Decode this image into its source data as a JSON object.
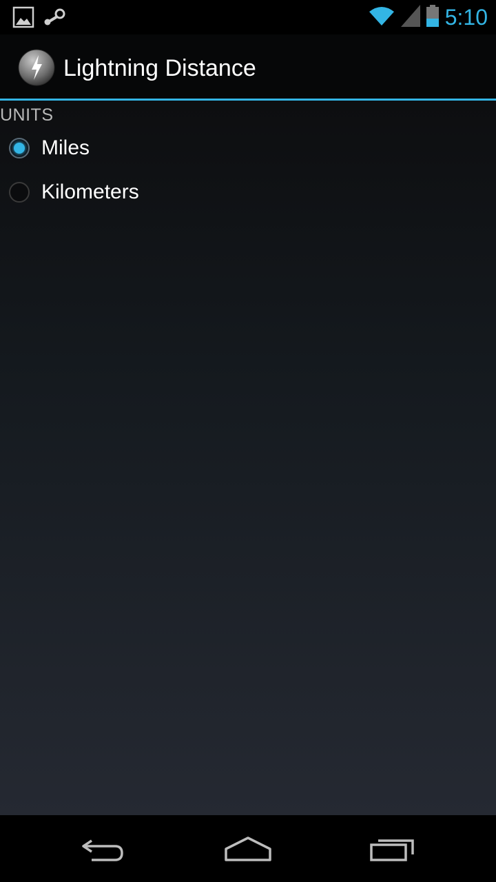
{
  "status_bar": {
    "time": "5:10",
    "icons": [
      "gallery-notification-icon",
      "steam-notification-icon",
      "wifi-icon",
      "signal-icon",
      "battery-icon"
    ],
    "accent_color": "#33b5e5"
  },
  "action_bar": {
    "title": "Lightning Distance",
    "app_icon": "lightning-bolt-icon"
  },
  "preferences": {
    "section_header": "UNITS",
    "options": [
      {
        "label": "Miles",
        "selected": true
      },
      {
        "label": "Kilometers",
        "selected": false
      }
    ]
  },
  "nav_bar": {
    "buttons": [
      "back-icon",
      "home-icon",
      "recents-icon"
    ]
  }
}
